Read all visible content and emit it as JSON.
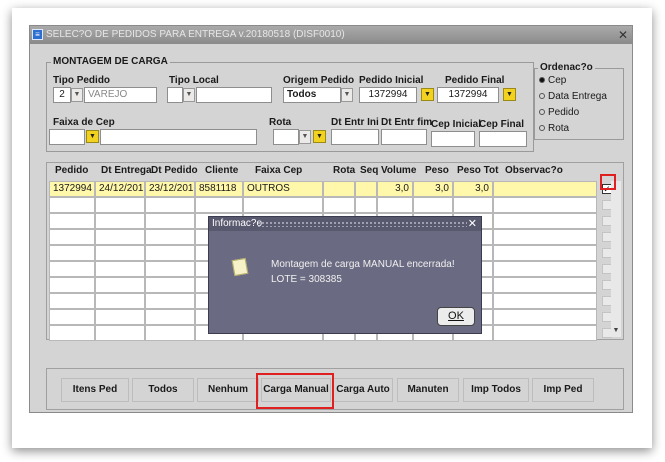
{
  "window": {
    "title": "SELEC?O DE PEDIDOS PARA ENTREGA v.20180518 (DISF0010)",
    "close_glyph": "✕"
  },
  "montagem": {
    "legend": "MONTAGEM DE CARGA",
    "tipo_pedido": {
      "label": "Tipo Pedido",
      "code": "2",
      "name": "VAREJO"
    },
    "tipo_local": {
      "label": "Tipo Local",
      "code": "",
      "name": ""
    },
    "origem_pedido": {
      "label": "Origem Pedido",
      "value": "Todos"
    },
    "pedido_inicial": {
      "label": "Pedido Inicial",
      "value": "1372994"
    },
    "pedido_final": {
      "label": "Pedido Final",
      "value": "1372994"
    },
    "faixa_cep": {
      "label": "Faixa de Cep",
      "value": ""
    },
    "rota": {
      "label": "Rota",
      "value": ""
    },
    "dt_entr_ini": {
      "label": "Dt Entr Ini",
      "value": ""
    },
    "dt_entr_fim": {
      "label": "Dt Entr fim",
      "value": ""
    },
    "cep_inicial": {
      "label": "Cep Inicial",
      "value": ""
    },
    "cep_final": {
      "label": "Cep Final",
      "value": ""
    }
  },
  "ordenacao": {
    "legend": "Ordenac?o",
    "options": [
      {
        "label": "Cep",
        "selected": true
      },
      {
        "label": "Data Entrega",
        "selected": false
      },
      {
        "label": "Pedido",
        "selected": false
      },
      {
        "label": "Rota",
        "selected": false
      }
    ]
  },
  "grid": {
    "headers": [
      "Pedido",
      "Dt Entrega",
      "Dt Pedido",
      "Cliente",
      "Faixa Cep",
      "Rota",
      "Seq",
      "Volume",
      "Peso",
      "Peso Tot",
      "Observac?o"
    ],
    "rows": [
      {
        "pedido": "1372994",
        "dt_entrega": "24/12/2019",
        "dt_pedido": "23/12/2019",
        "cliente": "8581118",
        "faixa_cep": "OUTROS",
        "rota": "",
        "seq": "",
        "volume": "3,0",
        "peso": "3,0",
        "peso_tot": "3,0",
        "observacao": "",
        "checked": true
      }
    ],
    "empty_rows": 9
  },
  "buttons": {
    "itens_ped": "Itens Ped",
    "todos": "Todos",
    "nenhum": "Nenhum",
    "carga_manual": "Carga Manual",
    "carga_auto": "Carga Auto",
    "manuten": "Manuten",
    "imp_todos": "Imp Todos",
    "imp_ped": "Imp Ped"
  },
  "dialog": {
    "title": "Informac?o",
    "message": "Montagem de carga MANUAL encerrada! LOTE = 308385",
    "ok_label": "OK",
    "icon": "note-icon"
  },
  "colors": {
    "accent_yellow": "#f3d21f",
    "selected_row": "#fff7a9",
    "highlight_red": "#e02020",
    "dialog_bg": "#6a6a82"
  }
}
